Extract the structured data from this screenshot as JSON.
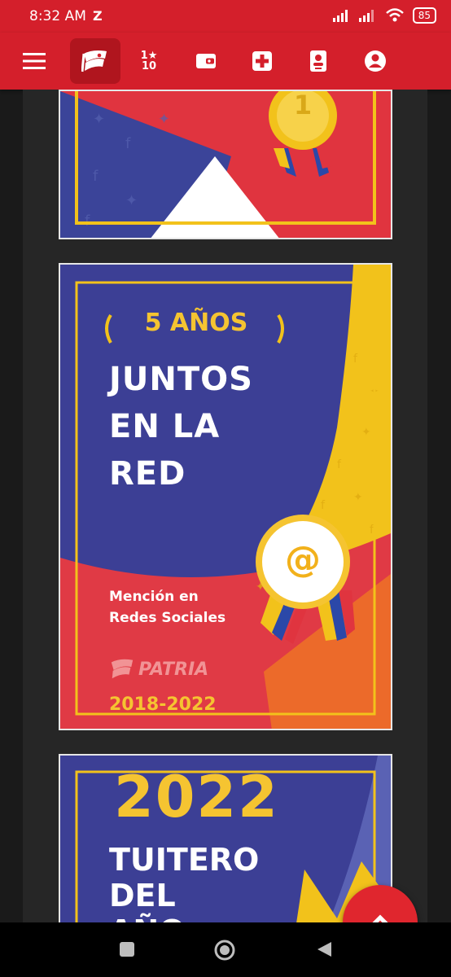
{
  "status_bar": {
    "time": "8:32 AM",
    "extra_indicator": "Z",
    "battery": "85"
  },
  "app_bar": {
    "items": [
      {
        "icon": "menu-icon"
      },
      {
        "icon": "patria-flag-icon",
        "active": true
      },
      {
        "icon": "top-ten-icon",
        "label_top": "1",
        "label_bottom": "10"
      },
      {
        "icon": "wallet-icon"
      },
      {
        "icon": "health-cross-icon"
      },
      {
        "icon": "id-card-icon"
      },
      {
        "icon": "account-icon"
      }
    ]
  },
  "cards": {
    "card2": {
      "years": "5 AÑOS",
      "title_line1": "JUNTOS",
      "title_line2": "EN LA",
      "title_line3": "RED",
      "mention_line1": "Mención en",
      "mention_line2": "Redes Sociales",
      "brand": "PATRIA",
      "period": "2018-2022",
      "badge_symbol": "@"
    },
    "card3": {
      "year": "2022",
      "title_line1": "TUITERO",
      "title_line2": "DEL",
      "title_line3": "AÑO"
    }
  },
  "colors": {
    "brand_red": "#d41f2b",
    "navy": "#3b3f8f",
    "yellow": "#f2c21b",
    "gold": "#f5c431"
  }
}
